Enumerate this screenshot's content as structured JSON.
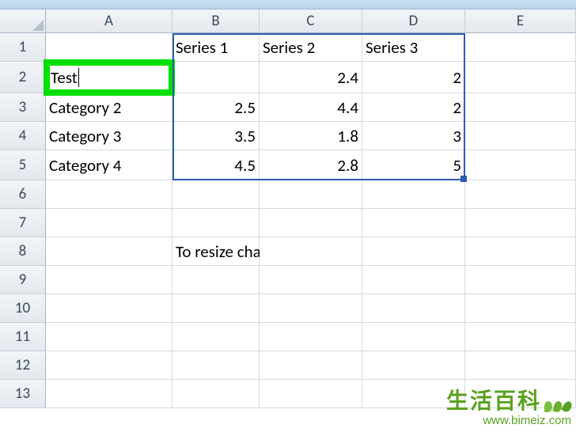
{
  "columns": {
    "A": "A",
    "B": "B",
    "C": "C",
    "D": "D",
    "E": "E"
  },
  "rowNums": {
    "1": "1",
    "2": "2",
    "3": "3",
    "4": "4",
    "5": "5",
    "6": "6",
    "7": "7",
    "8": "8",
    "9": "9",
    "10": "10",
    "11": "11",
    "12": "12",
    "13": "13"
  },
  "cells": {
    "B1": "Series 1",
    "C1": "Series 2",
    "D1": "Series 3",
    "A2": "Test",
    "C2": "2.4",
    "D2": "2",
    "A3": "Category 2",
    "B3": "2.5",
    "C3": "4.4",
    "D3": "2",
    "A4": "Category 3",
    "B4": "3.5",
    "C4": "1.8",
    "D4": "3",
    "A5": "Category 4",
    "B5": "4.5",
    "C5": "2.8",
    "D5": "5",
    "B8": "To resize chart data range, drag lower right"
  },
  "watermark": {
    "cn": "生活百科",
    "url": "www.bimeiz.com"
  }
}
